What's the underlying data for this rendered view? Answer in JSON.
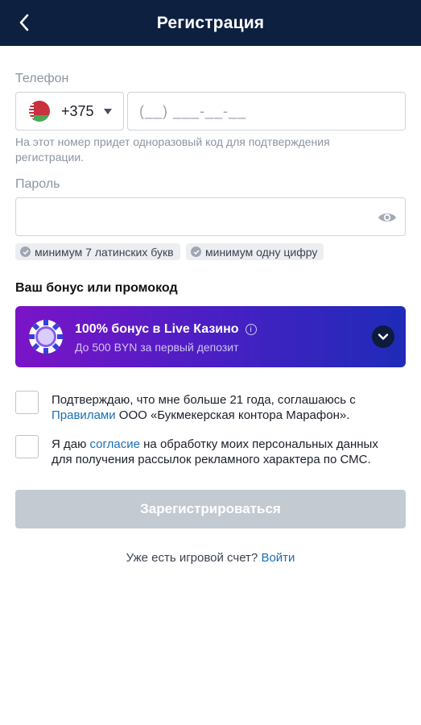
{
  "header": {
    "title": "Регистрация",
    "back_icon": "chevron-left-icon"
  },
  "phone": {
    "label": "Телефон",
    "country_code": "+375",
    "country_flag": "belarus-flag-icon",
    "placeholder": "(__) ___-__-__",
    "value": "",
    "hint": "На этот номер придет одноразовый код для подтверждения регистрации."
  },
  "password": {
    "label": "Пароль",
    "value": "",
    "eye_icon": "eye-icon",
    "rules": [
      {
        "text": "минимум 7 латинских букв"
      },
      {
        "text": "минимум одну цифру"
      }
    ]
  },
  "bonus": {
    "section_title": "Ваш бонус или промокод",
    "title": "100% бонус в Live Казино",
    "subtitle": "До 500 BYN за первый депозит",
    "info_glyph": "i",
    "icon": "casino-chip-icon",
    "expand_icon": "chevron-down-icon",
    "colors": {
      "gradient_start": "#7b14c7",
      "gradient_end": "#1f2bb8"
    }
  },
  "consents": [
    {
      "checked": false,
      "text_before": "Подтверждаю, что мне больше 21 года, соглашаюсь с ",
      "link": "Правилами",
      "text_after": " ООО «Букмекерская контора Марафон»."
    },
    {
      "checked": false,
      "text_before": "Я даю ",
      "link": "согласие",
      "text_after": " на обработку моих персональных данных для получения рассылок рекламного характера по СМС."
    }
  ],
  "register_button": {
    "label": "Зарегистрироваться",
    "disabled": true
  },
  "login": {
    "text": "Уже есть игровой счет? ",
    "link": "Войти"
  },
  "colors": {
    "header_bg": "#0d2040",
    "link": "#1a6fb5",
    "button_disabled": "#c4cad2"
  }
}
